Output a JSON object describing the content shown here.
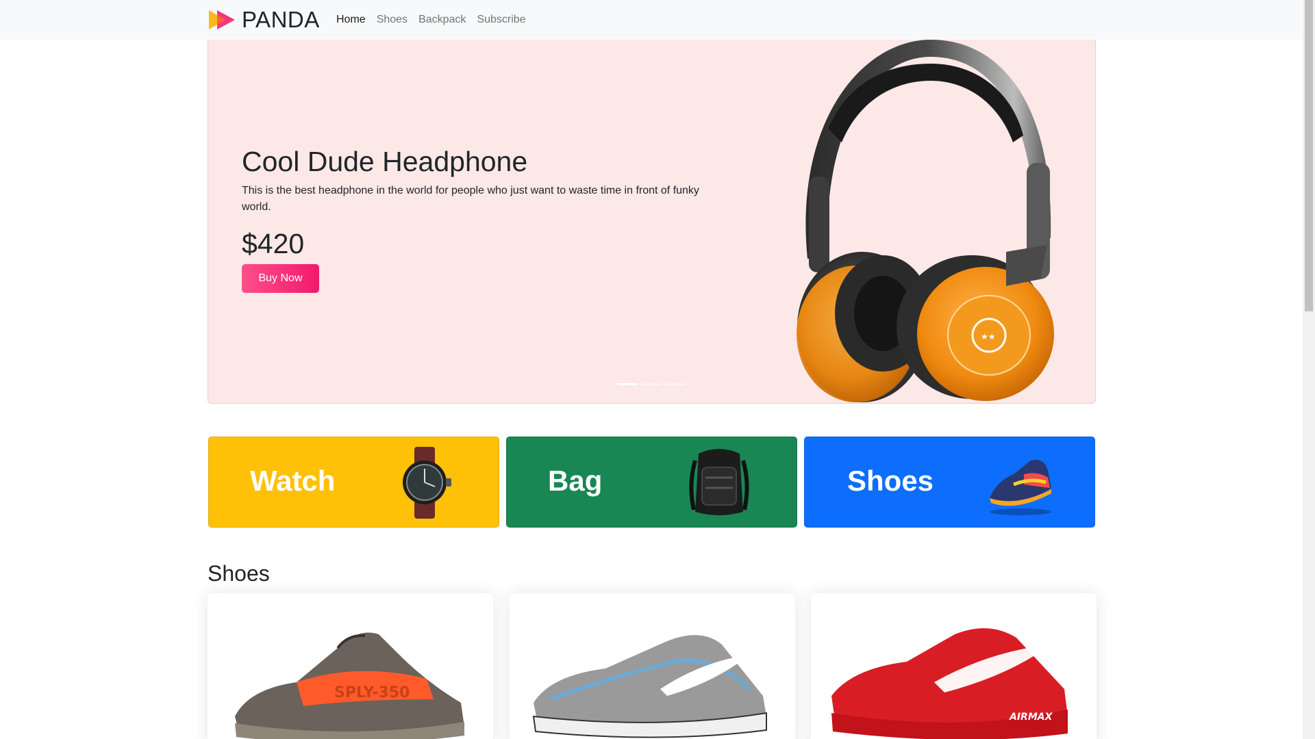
{
  "navbar": {
    "brand": "PANDA",
    "links": [
      {
        "label": "Home",
        "active": true
      },
      {
        "label": "Shoes",
        "active": false
      },
      {
        "label": "Backpack",
        "active": false
      },
      {
        "label": "Subscribe",
        "active": false
      }
    ]
  },
  "hero": {
    "title": "Cool Dude Headphone",
    "description": "This is the best headphone in the world for people who just want to waste time in front of funky world.",
    "price": "$420",
    "button_label": "Buy Now",
    "slide_count": 3,
    "active_slide": 1
  },
  "categories": [
    {
      "label": "Watch",
      "color": "#ffc107"
    },
    {
      "label": "Bag",
      "color": "#198754"
    },
    {
      "label": "Shoes",
      "color": "#0d6efd"
    }
  ],
  "shoes_section": {
    "title": "Shoes"
  },
  "colors": {
    "accent": "#f21a6c",
    "hero_bg": "#fbe8e7"
  }
}
